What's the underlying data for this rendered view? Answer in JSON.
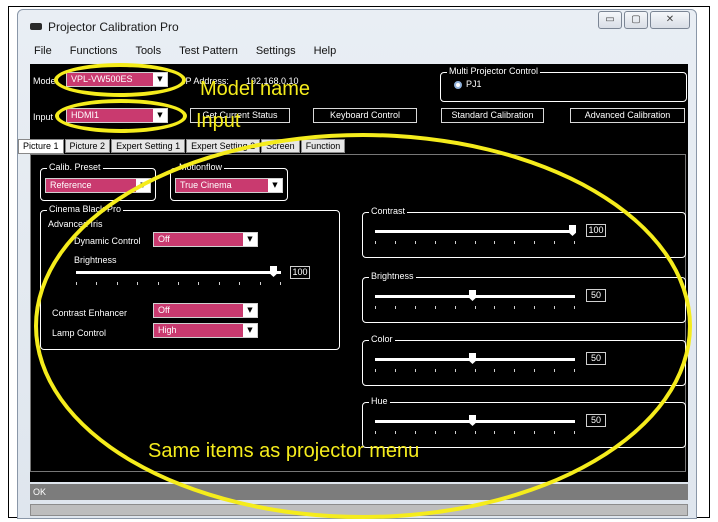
{
  "window": {
    "title": "Projector Calibration Pro",
    "buttons": {
      "minimize": "▭",
      "maximize": "▢",
      "close": "✕"
    }
  },
  "menu": [
    "File",
    "Functions",
    "Tools",
    "Test Pattern",
    "Settings",
    "Help"
  ],
  "top": {
    "model_label": "Model",
    "model_value": "VPL-VW500ES",
    "ip_label": "IP Address:",
    "ip_value": "192.168.0.10",
    "input_label": "Input",
    "input_value": "HDMI1",
    "multi_projector_title": "Multi Projector Control",
    "multi_projector_option": "PJ1",
    "buttons": [
      "Get Current Status",
      "Keyboard Control",
      "Standard Calibration",
      "Advanced Calibration"
    ]
  },
  "tabs": [
    "Picture 1",
    "Picture 2",
    "Expert Setting 1",
    "Expert Setting 2",
    "Screen",
    "Function"
  ],
  "picture": {
    "calib_preset_title": "Calib. Preset",
    "calib_preset_value": "Reference",
    "motionflow_title": "Motionflow",
    "motionflow_value": "True Cinema",
    "cinema_black_title": "Cinema Black Pro",
    "advanced_iris_label": "Advanced Iris",
    "dynamic_control_label": "Dynamic Control",
    "dynamic_control_value": "Off",
    "brightness_iris_label": "Brightness",
    "brightness_iris_value": "100",
    "contrast_enhancer_label": "Contrast Enhancer",
    "contrast_enhancer_value": "Off",
    "lamp_control_label": "Lamp Control",
    "lamp_control_value": "High",
    "sliders": [
      {
        "title": "Contrast",
        "value": "100",
        "level": 1.0
      },
      {
        "title": "Brightness",
        "value": "50",
        "level": 0.5
      },
      {
        "title": "Color",
        "value": "50",
        "level": 0.5
      },
      {
        "title": "Hue",
        "value": "50",
        "level": 0.5
      }
    ]
  },
  "status": "OK",
  "annotations": {
    "model": "Model name",
    "input": "Input",
    "menu": "Same items as projector menu"
  },
  "colors": {
    "annotation": "#f5ec1c",
    "dropdown": "#c93a6f",
    "background": "#000000"
  }
}
